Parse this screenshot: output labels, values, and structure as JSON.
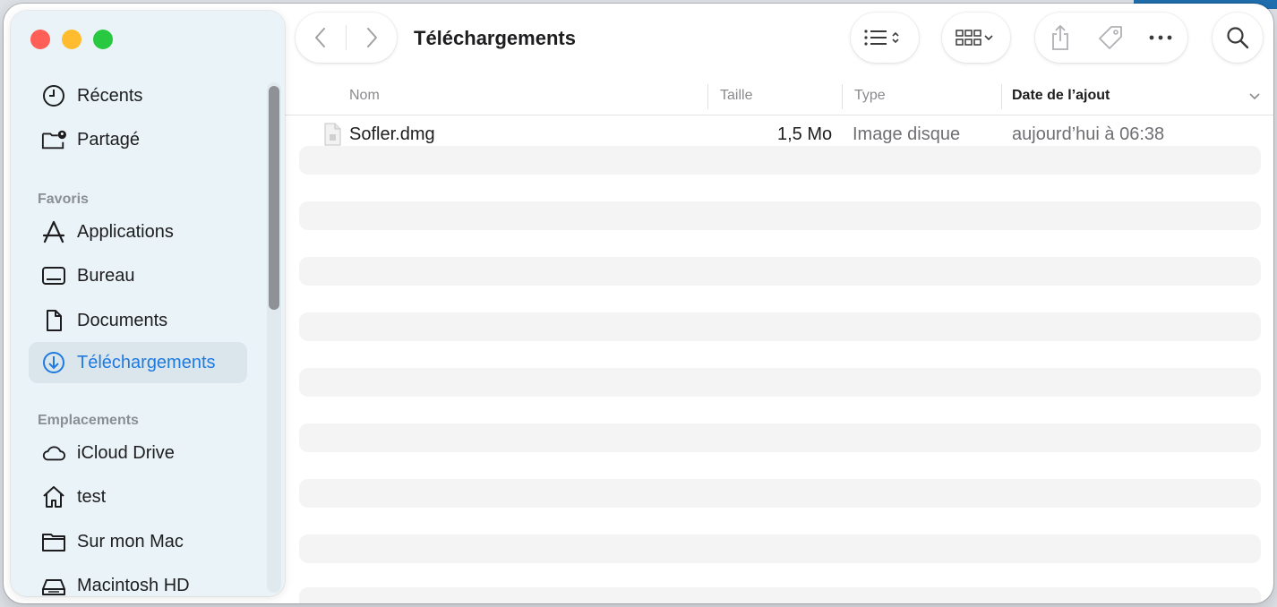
{
  "window": {
    "title": "Téléchargements"
  },
  "sidebar": {
    "recent_items": [
      {
        "label": "Récents",
        "icon": "clock-icon"
      },
      {
        "label": "Partagé",
        "icon": "shared-folder-icon"
      }
    ],
    "favorites_title": "Favoris",
    "favorites": [
      {
        "label": "Applications",
        "icon": "applications-icon"
      },
      {
        "label": "Bureau",
        "icon": "desktop-icon"
      },
      {
        "label": "Documents",
        "icon": "document-icon"
      },
      {
        "label": "Téléchargements",
        "icon": "download-icon",
        "selected": true
      }
    ],
    "locations_title": "Emplacements",
    "locations": [
      {
        "label": "iCloud Drive",
        "icon": "cloud-icon"
      },
      {
        "label": "test",
        "icon": "home-icon"
      },
      {
        "label": "Sur mon Mac",
        "icon": "folder-icon"
      },
      {
        "label": "Macintosh HD",
        "icon": "drive-icon"
      }
    ]
  },
  "columns": {
    "name": "Nom",
    "size": "Taille",
    "type": "Type",
    "date_added": "Date de l’ajout"
  },
  "files": [
    {
      "name": "Sofler.dmg",
      "size": "1,5 Mo",
      "type": "Image disque",
      "date_added": "aujourd’hui à 06:38"
    }
  ],
  "colors": {
    "accent": "#1f7ae0",
    "selected_bg": "#dbe6ec"
  }
}
